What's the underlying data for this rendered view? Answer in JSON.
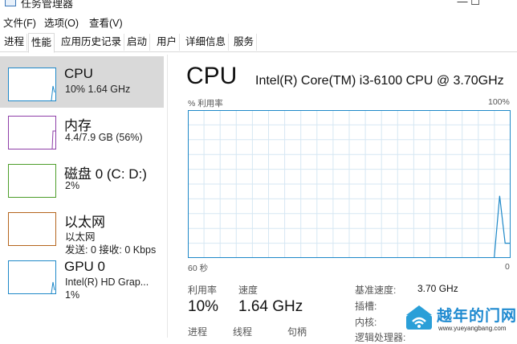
{
  "window": {
    "title": "任务管理器",
    "controls": [
      "—",
      "☐"
    ]
  },
  "menu": [
    {
      "label": "文件(F)"
    },
    {
      "label": "选项(O)"
    },
    {
      "label": "查看(V)"
    }
  ],
  "tabs": [
    {
      "label": "进程"
    },
    {
      "label": "性能"
    },
    {
      "label": "应用历史记录"
    },
    {
      "label": "启动"
    },
    {
      "label": "用户"
    },
    {
      "label": "详细信息"
    },
    {
      "label": "服务"
    }
  ],
  "active_tab": "性能",
  "sidebar": {
    "items": [
      {
        "title": "CPU",
        "line1": "10%  1.64 GHz",
        "line2": "",
        "color": "#1e88c8",
        "selected": true
      },
      {
        "title": "内存",
        "line1": "4.4/7.9 GB (56%)",
        "line2": "",
        "color": "#8e3fa8",
        "selected": false
      },
      {
        "title": "磁盘 0 (C: D:)",
        "line1": "2%",
        "line2": "",
        "color": "#4d9e2a",
        "selected": false
      },
      {
        "title": "以太网",
        "line1": "以太网",
        "line2": "发送: 0  接收: 0 Kbps",
        "color": "#b5651d",
        "selected": false
      },
      {
        "title": "GPU 0",
        "line1": "Intel(R) HD Grap...",
        "line2": "1%",
        "color": "#1e88c8",
        "selected": false
      }
    ]
  },
  "main": {
    "title": "CPU",
    "model": "Intel(R) Core(TM) i3-6100 CPU @ 3.70GHz",
    "graph": {
      "y_label": "% 利用率",
      "y_max_label": "100%",
      "x_left_label": "60 秒",
      "x_right_label": "0",
      "line_color": "#1e88c8",
      "grid_color": "#d6e7f3",
      "utilization_percent": [
        0,
        0,
        0,
        0,
        0,
        0,
        0,
        0,
        0,
        0,
        0,
        0,
        0,
        0,
        0,
        0,
        0,
        0,
        0,
        0,
        0,
        0,
        0,
        0,
        0,
        0,
        0,
        0,
        0,
        0,
        0,
        0,
        0,
        0,
        0,
        0,
        0,
        0,
        0,
        0,
        0,
        0,
        0,
        0,
        0,
        0,
        0,
        0,
        0,
        0,
        0,
        0,
        0,
        0,
        0,
        0,
        0,
        42,
        10,
        10
      ]
    },
    "stats": {
      "utilization_label": "利用率",
      "utilization_value": "10%",
      "speed_label": "速度",
      "speed_value": "1.64 GHz",
      "processes_label": "进程",
      "threads_label": "线程",
      "handles_label": "句柄"
    },
    "specs": {
      "base_speed_label": "基准速度:",
      "base_speed_value": "3.70 GHz",
      "sockets_label": "插槽:",
      "cores_label": "内核:",
      "logical_label": "逻辑处理器:"
    }
  },
  "watermark": {
    "text": "越年的门网",
    "url": "www.yueyangbang.com"
  }
}
